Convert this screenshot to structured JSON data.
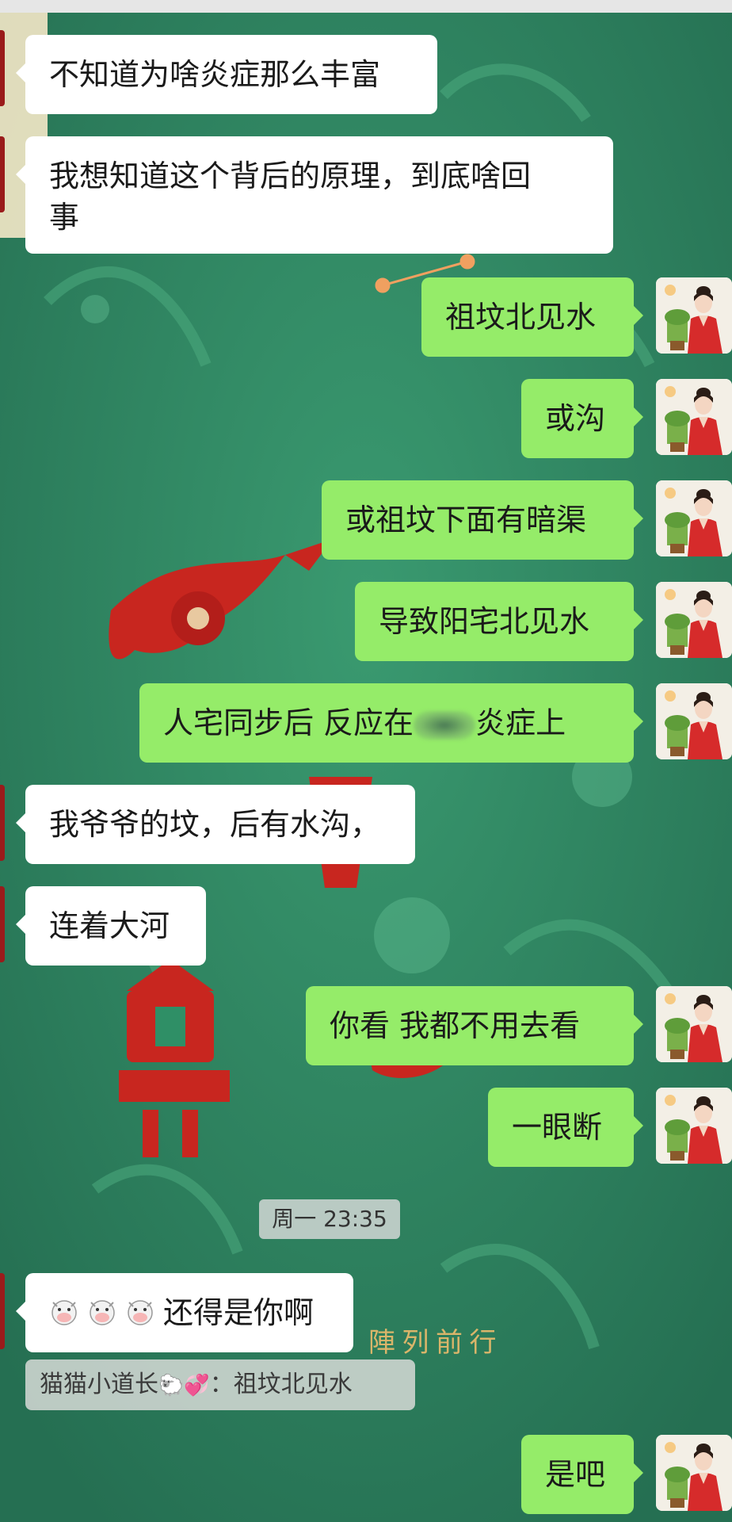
{
  "chat": {
    "messages": [
      {
        "side": "in",
        "text": "不知道为啥炎症那么丰富"
      },
      {
        "side": "in",
        "line1": "我想知道这个背后的原理，到底啥回",
        "line2": "事"
      },
      {
        "side": "out",
        "text": "祖坟北见水"
      },
      {
        "side": "out",
        "text": "或沟"
      },
      {
        "side": "out",
        "text": "或祖坟下面有暗渠"
      },
      {
        "side": "out",
        "text": "导致阳宅北见水"
      },
      {
        "side": "out",
        "text_before": "人宅同步后  反应在",
        "text_after": "炎症上"
      },
      {
        "side": "in",
        "text": "我爷爷的坟，后有水沟，"
      },
      {
        "side": "in",
        "text": "连着大河"
      },
      {
        "side": "out",
        "text": "你看  我都不用去看"
      },
      {
        "side": "out",
        "text": "一眼断"
      },
      {
        "side": "in",
        "text": "还得是你啊"
      },
      {
        "side": "out",
        "text": "是吧"
      }
    ],
    "timestamp": "周一  23:35",
    "quote": {
      "sender": "猫猫小道长",
      "sep": "：",
      "text": "祖坟北见水"
    },
    "background_text": "陣 列 前 行"
  },
  "colors": {
    "incoming_bubble": "#ffffff",
    "outgoing_bubble": "#95ec69",
    "background": "#2f8f66"
  },
  "icons": {
    "avatar": "woman-in-red-avatar",
    "cow": "cow-emoji",
    "sheep": "sheep-emoji",
    "hearts": "sparkling-hearts-emoji"
  }
}
